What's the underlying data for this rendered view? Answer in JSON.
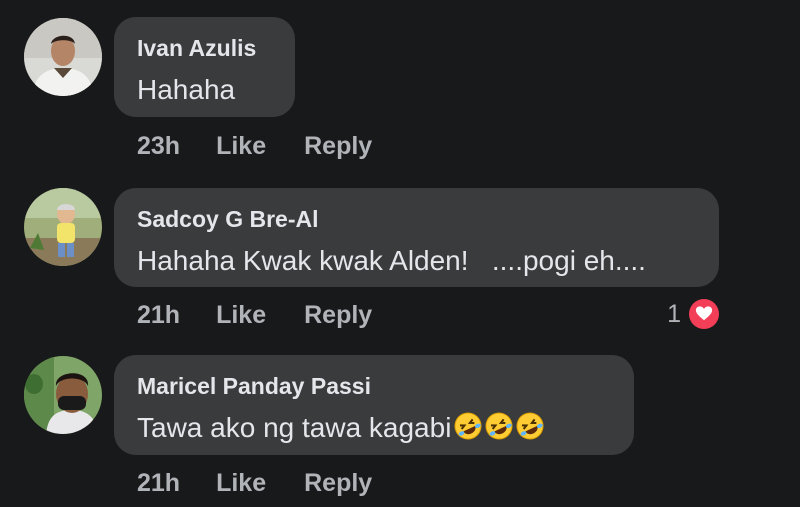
{
  "comments": [
    {
      "author": "Ivan Azulis",
      "text": "Hahaha",
      "time": "23h",
      "like_label": "Like",
      "reply_label": "Reply"
    },
    {
      "author": "Sadcoy G Bre-Al",
      "text": "Hahaha Kwak kwak Alden!   ....pogi eh....",
      "time": "21h",
      "like_label": "Like",
      "reply_label": "Reply",
      "reaction_count": "1",
      "reaction_icon": "heart-icon"
    },
    {
      "author": "Maricel Panday Passi",
      "text": "Tawa ako ng tawa kagabi",
      "emojis": [
        "rolling-laughing-emoji",
        "rolling-laughing-emoji",
        "rolling-laughing-emoji"
      ],
      "time": "21h",
      "like_label": "Like",
      "reply_label": "Reply"
    }
  ],
  "colors": {
    "background": "#18191a",
    "bubble": "#3a3b3c",
    "text_primary": "#e4e6eb",
    "text_secondary": "#b0b3b8",
    "heart": "#f33e58"
  }
}
